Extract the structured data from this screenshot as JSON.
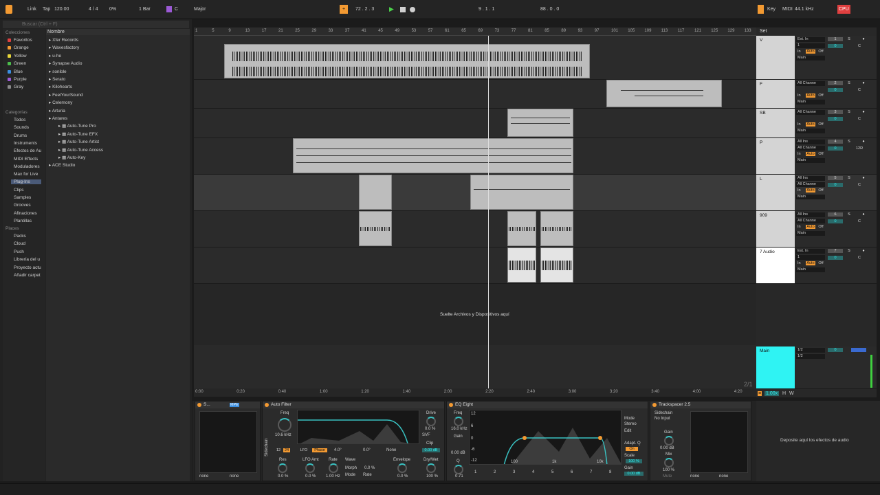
{
  "top": {
    "link": "Link",
    "tap": "Tap",
    "tempo": "120.00",
    "sig": "4 / 4",
    "pct": "0%",
    "quant": "1 Bar",
    "key": "C",
    "scale": "Major",
    "position": "72 .  2 .  3",
    "loop": "9 .  1 .  1",
    "length": "88 .  0 .  0",
    "key_btn": "Key",
    "midi_btn": "MIDI",
    "rate": "44.1 kHz",
    "cpu": "CPU"
  },
  "browser": {
    "search": "Buscar (Ctrl + F)",
    "col_header": "Nombre",
    "collections_title": "Colecciones",
    "collections": [
      {
        "label": "Favoritos",
        "color": "#e04040"
      },
      {
        "label": "Orange",
        "color": "#f39a32"
      },
      {
        "label": "Yellow",
        "color": "#e7d63a"
      },
      {
        "label": "Green",
        "color": "#4bbd4b"
      },
      {
        "label": "Blue",
        "color": "#3a8ee0"
      },
      {
        "label": "Purple",
        "color": "#9c5ad6"
      },
      {
        "label": "Gray",
        "color": "#8a8a8a"
      }
    ],
    "categories_title": "Categorías",
    "categories": [
      "Todos",
      "Sounds",
      "Drums",
      "Instruments",
      "Efectos de Au",
      "MIDI Effects",
      "Moduladores",
      "Max for Live",
      "Plug-Ins",
      "Clips",
      "Samples",
      "Grooves",
      "Afinaciones",
      "Plantillas"
    ],
    "places_title": "Places",
    "places": [
      "Packs",
      "Cloud",
      "Push",
      "Librería del u",
      "Proyecto actu",
      "Añadir carpet"
    ],
    "items": [
      "Xfer Records",
      "Wavesfactory",
      "u-he",
      "Synapse Audio",
      "sonible",
      "Serato",
      "Kilohearts",
      "FeelYourSound",
      "Celemony",
      "Arturia",
      "Antares",
      "Auto-Tune Pro",
      "Auto-Tune EFX",
      "Auto-Tune Artist",
      "Auto-Tune Access",
      "Auto-Key",
      "ACE Studio"
    ]
  },
  "ruler": [
    "1",
    "5",
    "9",
    "13",
    "17",
    "21",
    "25",
    "29",
    "33",
    "37",
    "41",
    "45",
    "49",
    "53",
    "57",
    "61",
    "65",
    "69",
    "73",
    "77",
    "81",
    "85",
    "89",
    "93",
    "97",
    "101",
    "105",
    "109",
    "113",
    "117",
    "121",
    "125",
    "129",
    "133"
  ],
  "timeline": [
    "0:00",
    "0:20",
    "0:40",
    "1:00",
    "1:20",
    "1:40",
    "2:00",
    "2:20",
    "2:40",
    "3:00",
    "3:20",
    "3:40",
    "4:00",
    "4:20"
  ],
  "drop_hint": "Suelte Archivos y Dispositivos aquí",
  "page_counter": "2/1",
  "set_label": "Set",
  "tracks": [
    {
      "name": "V",
      "in": "Ext. In",
      "ch": "1",
      "num": "1"
    },
    {
      "name": "F",
      "in": "All Channe",
      "ch": "",
      "num": "2"
    },
    {
      "name": "SB",
      "in": "All Channe",
      "ch": "",
      "num": "3"
    },
    {
      "name": "P",
      "in": "All Ins",
      "ch": "All Channe",
      "num": "4"
    },
    {
      "name": "L",
      "in": "All Ins",
      "ch": "All Channe",
      "num": "5"
    },
    {
      "name": "909",
      "in": "All Ins",
      "ch": "All Channe",
      "num": "6"
    },
    {
      "name": "7 Audio",
      "in": "Ext. In",
      "ch": "1",
      "num": "7"
    }
  ],
  "io": {
    "in": "In",
    "auto": "Auto",
    "off": "Off",
    "out": "Main",
    "s": "S",
    "c": "C",
    "vol": "0",
    "pan_p": "12R"
  },
  "main": {
    "name": "Main",
    "out1": "1/2",
    "out2": "1/2",
    "vol": "0",
    "zoom": "1.00x",
    "h": "H",
    "w": "W"
  },
  "devices": {
    "autofilter": {
      "title": "Auto Filter",
      "freq_label": "Freq",
      "freq": "10.6 kHz",
      "drive": "Drive",
      "drive_val": "0.0 %",
      "type": "SVF",
      "clip": "Clip",
      "clip_val": "0.00 dB",
      "lfo": "LFO",
      "phase": "Phase",
      "phase_val": "4.0°",
      "offset": "0.0°",
      "none": "None",
      "res": "Res",
      "res_val": "0.0 %",
      "lfo_amt": "LFO Amt",
      "lfo_amt_val": "0.0 %",
      "rate": "Rate",
      "rate_val": "1.00 Hz",
      "wave": "Wave",
      "morph": "Morph",
      "morph_val": "0.0 %",
      "mode": "Mode",
      "mode_val": "Rate",
      "envelope": "Envelope",
      "env_val": "0.0 %",
      "drywet": "Dry/Wet",
      "drywet_val": "100 %",
      "n12": "12",
      "n24": "24",
      "sidechain": "Sidechain"
    },
    "eq": {
      "title": "EQ Eight",
      "freq": "Freq",
      "freq_val": "16.0 kHz",
      "gain": "Gain",
      "gain_val": "0.00 dB",
      "q": "Q",
      "q_val": "0.71",
      "mode": "Mode",
      "mode_val": "Stereo",
      "edit": "Edit",
      "adapt": "Adapt. Q",
      "on": "On",
      "scale": "Scale",
      "scale_val": "100 %",
      "gain2": "Gain",
      "gain2_val": "0.00 dB",
      "y12": "12",
      "y6": "6",
      "y0": "0",
      "y-6": "-6",
      "y-12": "-12",
      "x100": "100",
      "x1k": "1k",
      "x10k": "10k",
      "bands": [
        "1",
        "2",
        "3",
        "4",
        "5",
        "6",
        "7",
        "8"
      ]
    },
    "track": {
      "title": "Trackspacer 2.5",
      "sidechain": "Sidechain",
      "input": "No Input",
      "gain": "Gain",
      "gain_val": "0.00 dB",
      "mix": "Mix",
      "mix_val": "100 %",
      "mute": "Mute",
      "none1": "none",
      "none2": "none"
    },
    "first": {
      "title": "S...",
      "mpe": "MPE",
      "none1": "none",
      "none2": "none"
    },
    "drop": "Deposite aquí los efectos de audio"
  }
}
